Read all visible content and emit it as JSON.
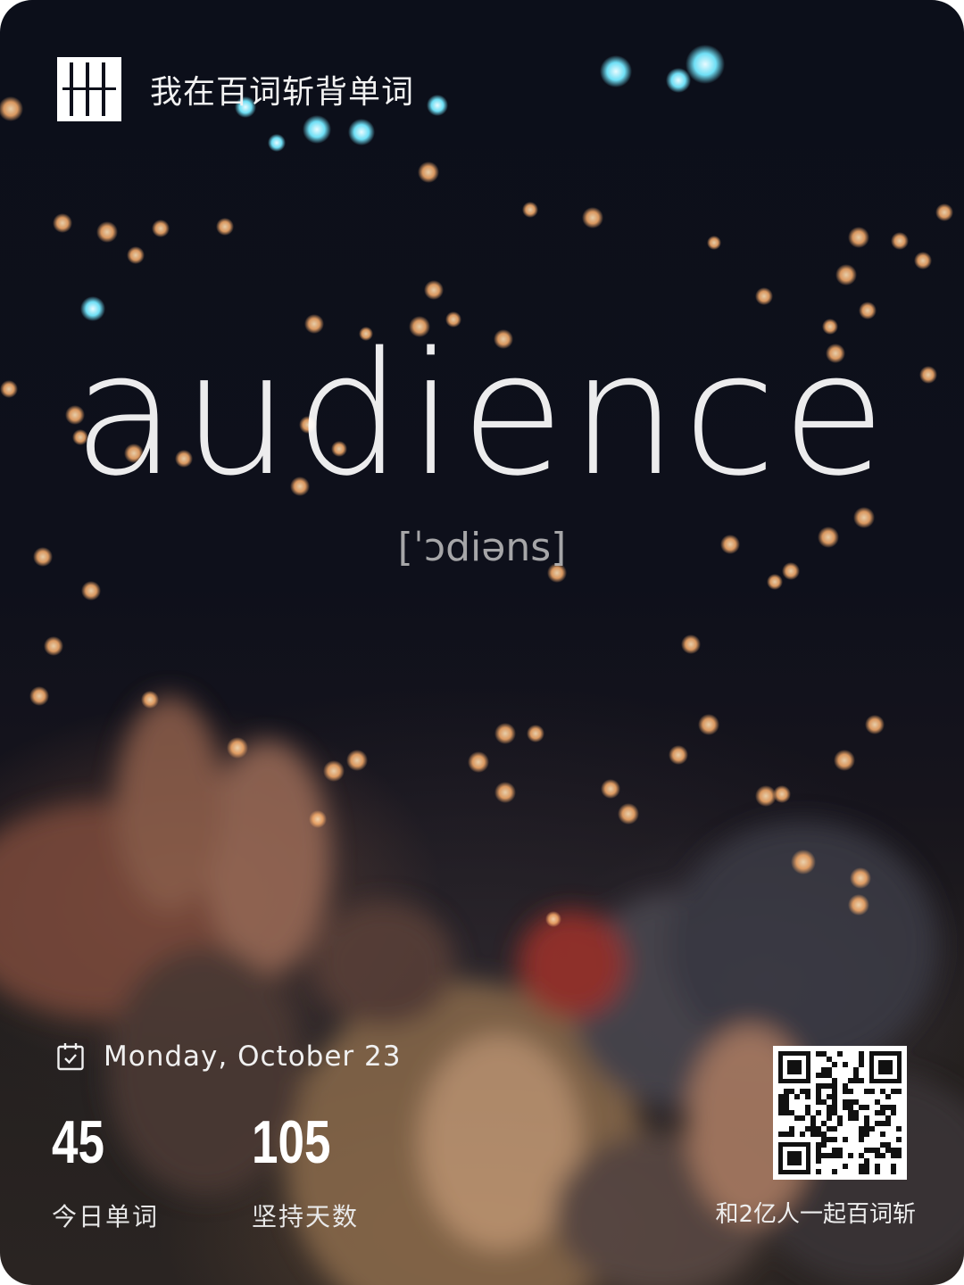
{
  "header": {
    "logo_icon": "baicizhan-logo-icon",
    "brand_text": "我在百词斩背单词"
  },
  "word_card": {
    "word": "audience",
    "phonetic": "[ˈɔdiəns]"
  },
  "footer": {
    "calendar_icon": "calendar-check-icon",
    "date": "Monday, October 23",
    "stats": [
      {
        "value": "45",
        "label": "今日单词"
      },
      {
        "value": "105",
        "label": "坚持天数"
      }
    ],
    "qr_caption": "和2亿人一起百词斩"
  },
  "colors": {
    "background": "#0e101b",
    "text_primary": "#ffffff",
    "bokeh_warm": "#f2b27a",
    "bokeh_cool": "#7fe6ff"
  }
}
